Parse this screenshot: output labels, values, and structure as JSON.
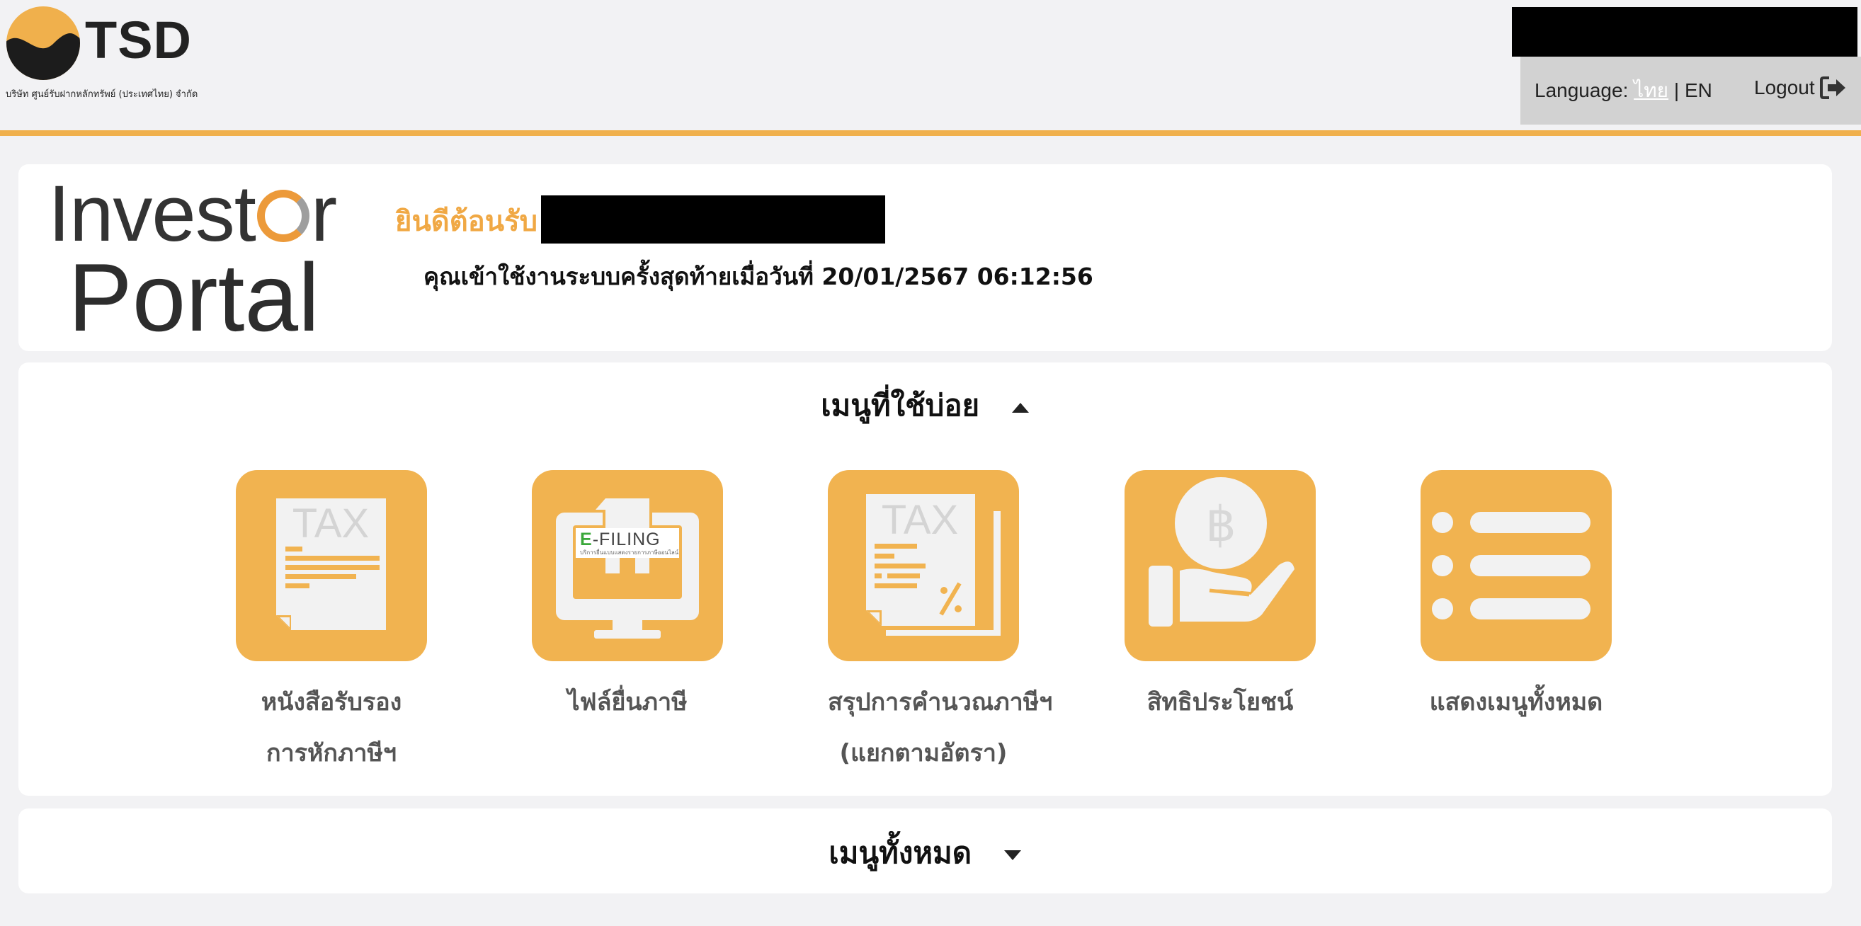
{
  "header": {
    "logo_text": "TSD",
    "company_name": "บริษัท ศูนย์รับฝากหลักทรัพย์ (ประเทศไทย) จำกัด",
    "language_label": "Language:",
    "lang_th": "ไทย",
    "lang_sep": "|",
    "lang_en": "EN",
    "logout_label": "Logout"
  },
  "welcome": {
    "logo_investor_pre": "Invest",
    "logo_investor_post": "r",
    "logo_portal": "Portal",
    "greeting": "ยินดีต้อนรับ",
    "last_login": "คุณเข้าใช้งานระบบครั้งสุดท้ายเมื่อวันที่ 20/01/2567 06:12:56"
  },
  "frequent_menu": {
    "title": "เมนูที่ใช้บ่อย",
    "items": [
      {
        "icon": "tax-certificate-icon",
        "line1": "หนังสือรับรอง",
        "line2": "การหักภาษีฯ",
        "icon_text": "TAX"
      },
      {
        "icon": "efiling-monitor-icon",
        "line1": "ไฟล์ยื่นภาษี",
        "line2": "",
        "badge_e": "E",
        "badge_rest": "-FILING",
        "badge_sub": "บริการยื่นแบบแสดงรายการภาษีออนไลน์"
      },
      {
        "icon": "tax-summary-icon",
        "line1": "สรุปการคำนวณภาษีฯ",
        "line2": "(แยกตามอัตรา)",
        "icon_text": "TAX"
      },
      {
        "icon": "baht-hand-icon",
        "line1": "สิทธิประโยชน์",
        "line2": "",
        "icon_text": "฿"
      },
      {
        "icon": "list-menu-icon",
        "line1": "แสดงเมนูทั้งหมด",
        "line2": ""
      }
    ]
  },
  "all_menu": {
    "title": "เมนูทั้งหมด"
  },
  "colors": {
    "accent_orange": "#f1b350",
    "title_orange": "#f0a844",
    "header_bg": "#f2f2f4",
    "lang_box": "#d2d2d2"
  }
}
